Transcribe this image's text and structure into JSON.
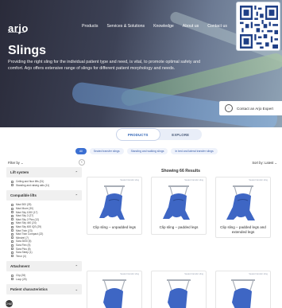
{
  "nav": {
    "logo": "arjo",
    "items": [
      "Products",
      "Services & Solutions",
      "Knowledge",
      "About us",
      "Contact us"
    ]
  },
  "hero": {
    "title": "Slings",
    "description": "Providing the right sling for the individual patient type and need, is vital, to promote optimal safety and comfort. Arjo offers extensive range of slings for different patient morphology and needs.",
    "expert_label": "Contact an Arjo Expert"
  },
  "tabs": [
    {
      "label": "PRODUCTS",
      "active": true
    },
    {
      "label": "EXPLORE",
      "active": false
    }
  ],
  "chips": [
    {
      "label": "All",
      "active": true
    },
    {
      "label": "Seated transfer slings",
      "active": false
    },
    {
      "label": "Standing and walking slings",
      "active": false
    },
    {
      "label": "In bed and lateral transfer slings",
      "active": false
    }
  ],
  "filter_label": "Filter by",
  "sort_label": "Sort by: Latest",
  "results_label": "Showing 66 Results",
  "facets": [
    {
      "title": "Lift system",
      "options": [
        "Ceiling and floor lifts (31)",
        "Standing and raising aids (11)"
      ]
    },
    {
      "title": "Compatible lifts",
      "options": [
        "Maxi 500 (25)",
        "Maxi Move (30)",
        "Maxi Sky 1000 (17)",
        "Maxi Sky 2 (27)",
        "Maxi Sky 2 Plus (12)",
        "Maxi Sky 440 (24)",
        "Maxi Sky 600 IQS (29)",
        "Maxi Twin (23)",
        "Maxi Twin Compact (22)",
        "Minstrel (7)",
        "Sara 3000 (5)",
        "Sara Flex (5)",
        "Sara Plus (5)",
        "Sara Stedy (1)",
        "Tenor (4)"
      ]
    },
    {
      "title": "Attachment",
      "options": [
        "Clip (28)",
        "Loop (25)"
      ]
    },
    {
      "title": "Patient characteristics",
      "options": []
    }
  ],
  "products": [
    {
      "name": "Clip sling – unpadded legs",
      "badge": "Seated transfer sling"
    },
    {
      "name": "Clip sling – padded legs",
      "badge": "Seated transfer sling"
    },
    {
      "name": "Clip sling – padded legs and extended legs",
      "badge": "Seated transfer sling"
    },
    {
      "name": "",
      "badge": "Seated transfer sling"
    },
    {
      "name": "",
      "badge": "Seated transfer sling"
    },
    {
      "name": "",
      "badge": "Seated transfer sling"
    }
  ],
  "chat_label": "CHAT",
  "colors": {
    "accent": "#3b6fd2",
    "sling_blue": "#3e66c4",
    "hanger": "#a9afb8"
  }
}
